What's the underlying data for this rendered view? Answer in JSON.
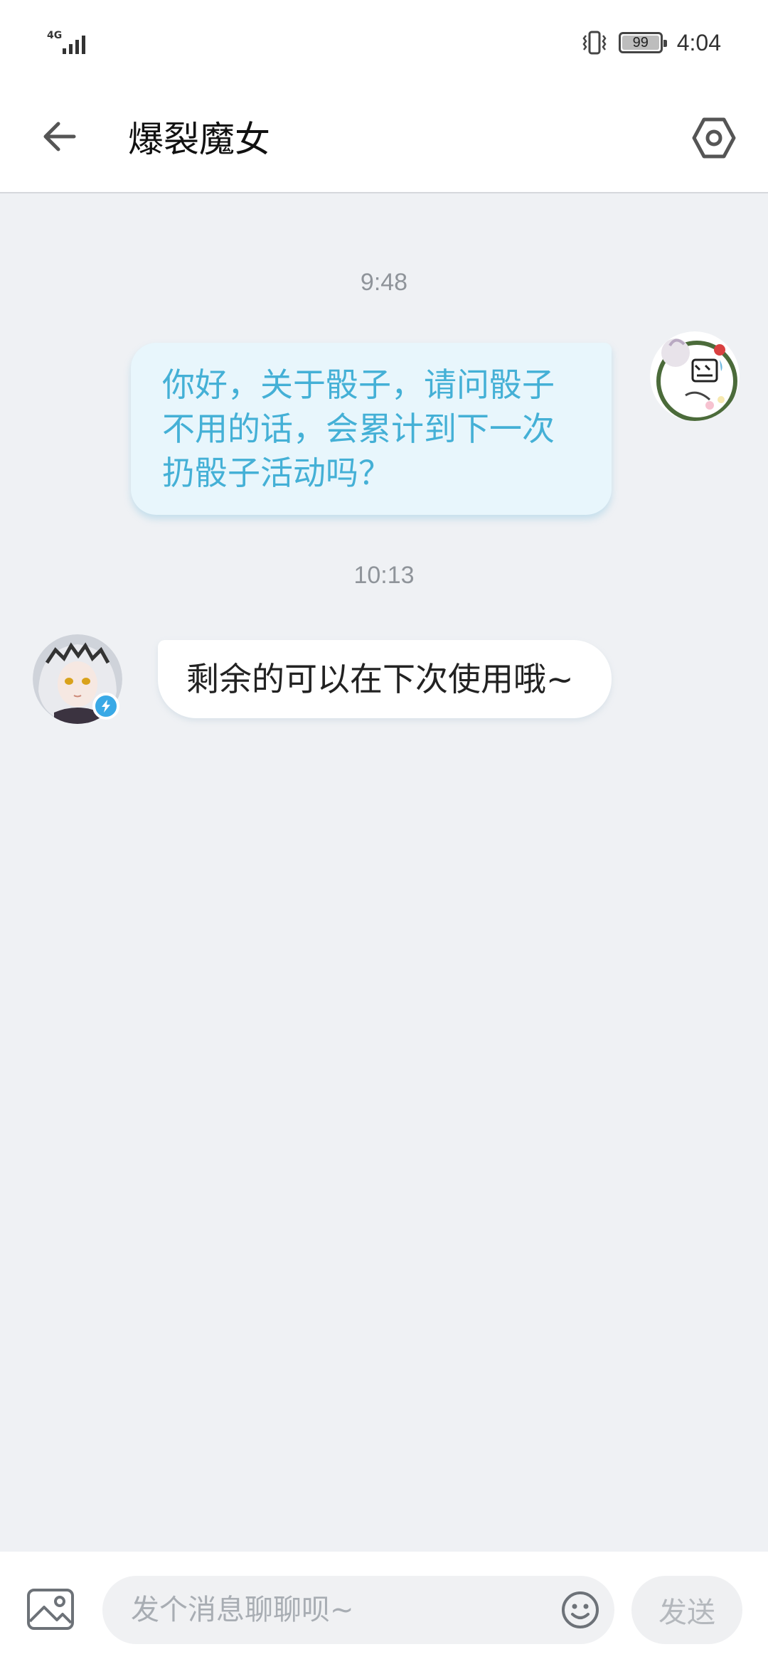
{
  "status_bar": {
    "network": "4G",
    "battery": "99",
    "time": "4:04"
  },
  "header": {
    "title": "爆裂魔女"
  },
  "messages": [
    {
      "timestamp": "9:48",
      "direction": "outgoing",
      "text": "你好，关于骰子，请问骰子不用的话，会累计到下一次扔骰子活动吗？"
    },
    {
      "timestamp": "10:13",
      "direction": "incoming",
      "text": "剩余的可以在下次使用哦~"
    }
  ],
  "composer": {
    "placeholder": "发个消息聊聊呗~",
    "send_label": "发送"
  },
  "icons": {
    "back": "arrow-left-icon",
    "settings": "hexagon-settings-icon",
    "image": "image-icon",
    "emoji": "smiley-icon",
    "verified": "lightning-badge-icon"
  },
  "colors": {
    "accent": "#44b0d6",
    "outgoing_bubble": "#e8f6fc",
    "background": "#eff1f4"
  }
}
